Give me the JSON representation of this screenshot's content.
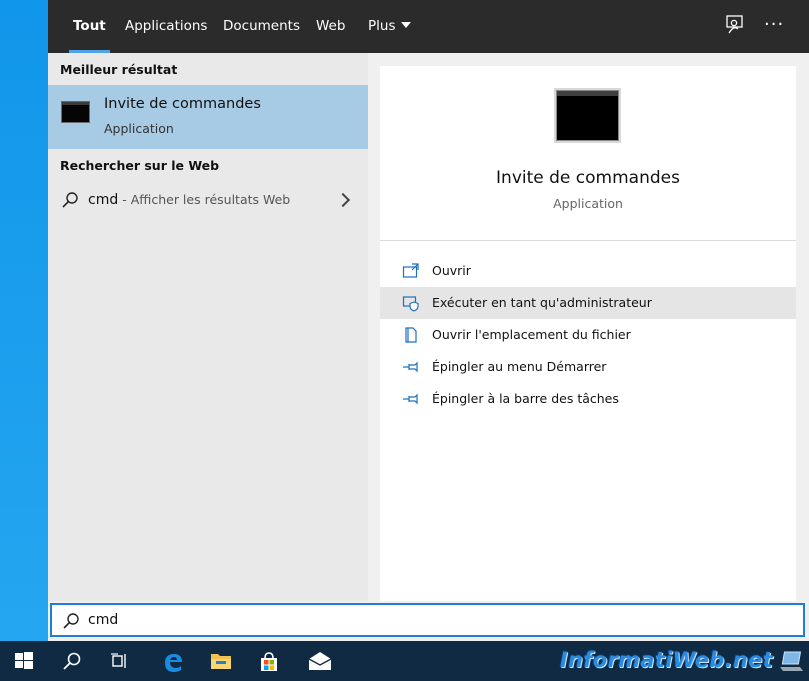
{
  "tabs": [
    {
      "label": "Tout",
      "active": true
    },
    {
      "label": "Applications",
      "active": false
    },
    {
      "label": "Documents",
      "active": false
    },
    {
      "label": "Web",
      "active": false
    },
    {
      "label": "Plus",
      "active": false
    }
  ],
  "top_icons": [
    "feedback-icon",
    "more-options-icon"
  ],
  "more_label": "···",
  "left": {
    "best_heading": "Meilleur résultat",
    "best_result": {
      "title": "Invite de commandes",
      "subtitle": "Application",
      "icon": "command-prompt-icon"
    },
    "web_heading": "Rechercher sur le Web",
    "web_result": {
      "query": "cmd",
      "hint": " - Afficher les résultats Web"
    }
  },
  "preview": {
    "title": "Invite de commandes",
    "subtitle": "Application",
    "actions": [
      {
        "label": "Ouvrir",
        "icon": "open-icon"
      },
      {
        "label": "Exécuter en tant qu'administrateur",
        "icon": "run-as-admin-icon",
        "highlighted": true
      },
      {
        "label": "Ouvrir l'emplacement du fichier",
        "icon": "file-location-icon"
      },
      {
        "label": "Épingler au menu Démarrer",
        "icon": "pin-icon"
      },
      {
        "label": "Épingler à la barre des tâches",
        "icon": "pin-icon"
      }
    ]
  },
  "search": {
    "value": "cmd",
    "placeholder": ""
  },
  "taskbar": {
    "buttons": [
      "windows-start-icon",
      "search-icon",
      "task-view-icon",
      "edge-icon",
      "file-explorer-icon",
      "store-icon",
      "mail-icon"
    ],
    "watermark": "InformatiWeb.net"
  },
  "colors": {
    "accent": "#1e7fd6",
    "selected": "#a8cbe5",
    "topbar": "#2b2b2b",
    "taskbar": "#102a43"
  }
}
